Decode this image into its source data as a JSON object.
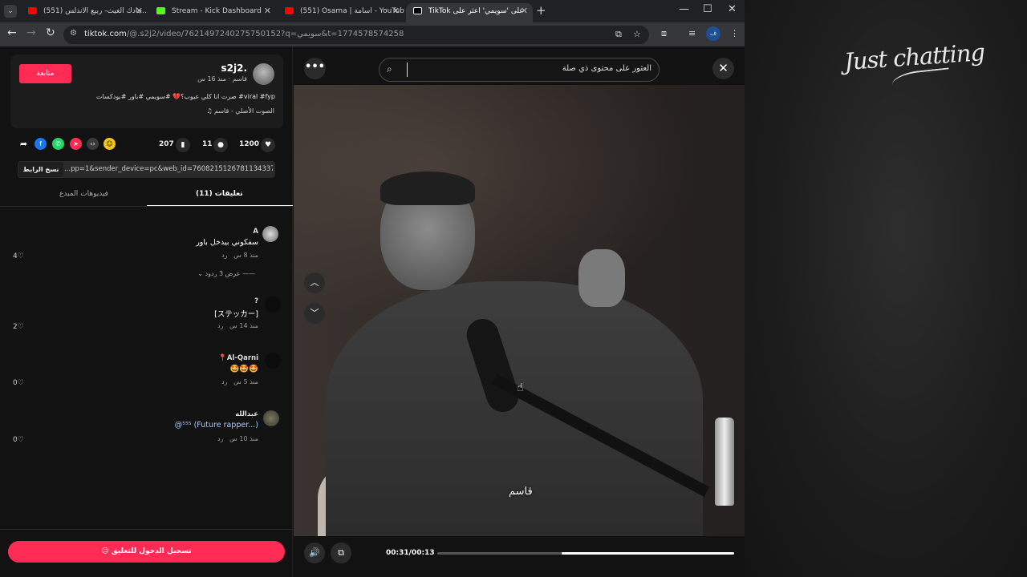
{
  "browser": {
    "tabs": [
      {
        "title": "(551) جادك الغيث- ربيع الاندلس...",
        "favicon": "youtube-icon",
        "color": "#ff0000"
      },
      {
        "title": "Stream - Kick Dashboard",
        "favicon": "kick-icon",
        "color": "#53fc18"
      },
      {
        "title": "(551) Osama | اسامة - YouTube",
        "favicon": "youtube-icon",
        "color": "#ff0000"
      },
      {
        "title": "TikTok على 'سويمي' اعثر على",
        "favicon": "tiktok-icon",
        "color": "#ffffff",
        "active": true
      }
    ],
    "url_domain": "tiktok.com",
    "url_path": "/@.s2j2/video/7621497240275750152?q=سويمي&t=1774578574258",
    "profile_initial": "ف"
  },
  "post": {
    "follow_label": "متابعة",
    "username": "s2j2.",
    "subtitle": "قاسم · منذ 16 س",
    "caption": "صرت انا كلي عيوب؟💔 #سويمي #باور #بودكسات #viral #fyp",
    "sound": "الصوت الأصلي - قاسم",
    "likes": "1200",
    "comments_count": "11",
    "saves": "207",
    "copy_label": "نسخ الرابط",
    "link": "...pp=1&sender_device=pc&web_id=7608215126781134337"
  },
  "tabs": {
    "comments": "(11) تعليقات",
    "creator_videos": "فيديوهات المبدع"
  },
  "comments": [
    {
      "name": "A",
      "text": "سفكوني بيدخل باور",
      "time": "منذ 8 س",
      "reply": "رد",
      "likes": "4"
    },
    {
      "name": "?",
      "text": "[ステッカー]",
      "time": "منذ 14 س",
      "reply": "رد",
      "likes": "2"
    },
    {
      "name": "📍Al-Qarni",
      "text": "🤩🤩🤩",
      "time": "منذ 5 س",
      "reply": "رد",
      "likes": "0"
    },
    {
      "name": "عبدالله",
      "text": "@⁵⁵⁵ (Future rapper...)",
      "time": "منذ 10 س",
      "reply": "رد",
      "likes": "0"
    }
  ],
  "view_replies": "عرض 3 ردود",
  "login_label": "تسجيل الدخول للتعليق",
  "search": {
    "placeholder": "العثور على محتوى ذي صلة"
  },
  "video": {
    "caption": "قاسم",
    "time": "00:31/00:13",
    "progress": 0.58
  },
  "overlay_brand": "Just chatting"
}
